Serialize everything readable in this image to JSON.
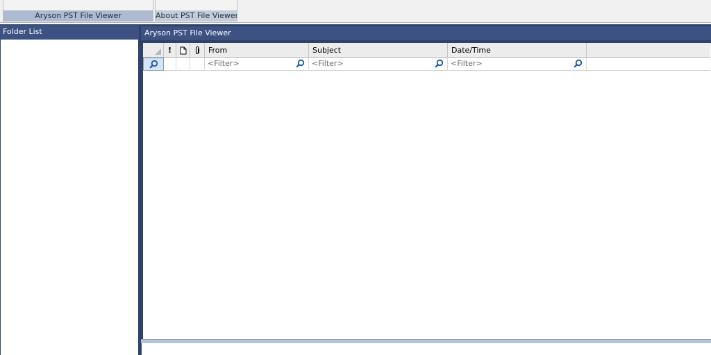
{
  "ribbon": {
    "groups": [
      {
        "label": "Aryson PST File Viewer"
      },
      {
        "label": "About PST File Viewer"
      }
    ]
  },
  "folder_pane": {
    "title": "Folder List"
  },
  "message_pane": {
    "title": "Aryson PST File Viewer",
    "columns": [
      {
        "icon": "importance-icon",
        "glyph": "!"
      },
      {
        "icon": "item-type-icon",
        "glyph": "🗋"
      },
      {
        "icon": "attachment-icon",
        "glyph": "🖇"
      },
      {
        "label": "From",
        "filter_placeholder": "<Filter>"
      },
      {
        "label": "Subject",
        "filter_placeholder": "<Filter>"
      },
      {
        "label": "Date/Time",
        "filter_placeholder": "<Filter>"
      }
    ],
    "rows": []
  },
  "colors": {
    "pane_header": "#3b5282",
    "frame": "#2f4368",
    "ribbon_group_label": "#aebad0",
    "filter_icon": "#1c5a9c"
  }
}
